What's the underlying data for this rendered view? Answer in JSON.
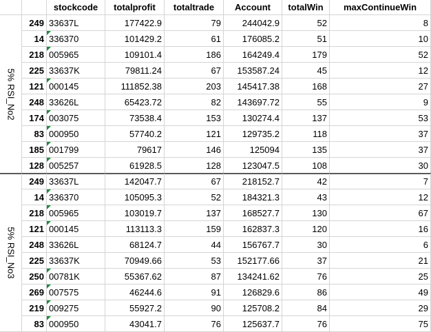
{
  "headers": [
    "",
    "",
    "stockcode",
    "totalprofit",
    "totaltrade",
    "Account",
    "totalWin",
    "maxContinueWin"
  ],
  "groups": [
    {
      "label": "5% RSI_No2",
      "rows": [
        {
          "idx": "249",
          "stockcode": "33637L",
          "totalprofit": "177422.9",
          "totaltrade": "79",
          "account": "244042.9",
          "totalwin": "52",
          "maxcontinuewin": "8",
          "flag": false
        },
        {
          "idx": "14",
          "stockcode": "336370",
          "totalprofit": "101429.2",
          "totaltrade": "61",
          "account": "176085.2",
          "totalwin": "51",
          "maxcontinuewin": "10",
          "flag": true
        },
        {
          "idx": "218",
          "stockcode": "005965",
          "totalprofit": "109101.4",
          "totaltrade": "186",
          "account": "164249.4",
          "totalwin": "179",
          "maxcontinuewin": "52",
          "flag": true
        },
        {
          "idx": "225",
          "stockcode": "33637K",
          "totalprofit": "79811.24",
          "totaltrade": "67",
          "account": "153587.24",
          "totalwin": "45",
          "maxcontinuewin": "12",
          "flag": false
        },
        {
          "idx": "121",
          "stockcode": "000145",
          "totalprofit": "111852.38",
          "totaltrade": "203",
          "account": "145417.38",
          "totalwin": "168",
          "maxcontinuewin": "27",
          "flag": true
        },
        {
          "idx": "248",
          "stockcode": "33626L",
          "totalprofit": "65423.72",
          "totaltrade": "82",
          "account": "143697.72",
          "totalwin": "55",
          "maxcontinuewin": "9",
          "flag": false
        },
        {
          "idx": "174",
          "stockcode": "003075",
          "totalprofit": "73538.4",
          "totaltrade": "153",
          "account": "130274.4",
          "totalwin": "137",
          "maxcontinuewin": "53",
          "flag": true
        },
        {
          "idx": "83",
          "stockcode": "000950",
          "totalprofit": "57740.2",
          "totaltrade": "121",
          "account": "129735.2",
          "totalwin": "118",
          "maxcontinuewin": "37",
          "flag": true
        },
        {
          "idx": "185",
          "stockcode": "001799",
          "totalprofit": "79617",
          "totaltrade": "146",
          "account": "125094",
          "totalwin": "135",
          "maxcontinuewin": "37",
          "flag": true
        },
        {
          "idx": "128",
          "stockcode": "005257",
          "totalprofit": "61928.5",
          "totaltrade": "128",
          "account": "123047.5",
          "totalwin": "108",
          "maxcontinuewin": "30",
          "flag": true
        }
      ]
    },
    {
      "label": "5% RSI_No3",
      "rows": [
        {
          "idx": "249",
          "stockcode": "33637L",
          "totalprofit": "142047.7",
          "totaltrade": "67",
          "account": "218152.7",
          "totalwin": "42",
          "maxcontinuewin": "7",
          "flag": false
        },
        {
          "idx": "14",
          "stockcode": "336370",
          "totalprofit": "105095.3",
          "totaltrade": "52",
          "account": "184321.3",
          "totalwin": "43",
          "maxcontinuewin": "12",
          "flag": true
        },
        {
          "idx": "218",
          "stockcode": "005965",
          "totalprofit": "103019.7",
          "totaltrade": "137",
          "account": "168527.7",
          "totalwin": "130",
          "maxcontinuewin": "67",
          "flag": true
        },
        {
          "idx": "121",
          "stockcode": "000145",
          "totalprofit": "113113.3",
          "totaltrade": "159",
          "account": "162837.3",
          "totalwin": "120",
          "maxcontinuewin": "16",
          "flag": true
        },
        {
          "idx": "248",
          "stockcode": "33626L",
          "totalprofit": "68124.7",
          "totaltrade": "44",
          "account": "156767.7",
          "totalwin": "30",
          "maxcontinuewin": "6",
          "flag": false
        },
        {
          "idx": "225",
          "stockcode": "33637K",
          "totalprofit": "70949.66",
          "totaltrade": "53",
          "account": "152177.66",
          "totalwin": "37",
          "maxcontinuewin": "21",
          "flag": false
        },
        {
          "idx": "250",
          "stockcode": "00781K",
          "totalprofit": "55367.62",
          "totaltrade": "87",
          "account": "134241.62",
          "totalwin": "76",
          "maxcontinuewin": "25",
          "flag": true
        },
        {
          "idx": "269",
          "stockcode": "007575",
          "totalprofit": "46244.6",
          "totaltrade": "91",
          "account": "126829.6",
          "totalwin": "86",
          "maxcontinuewin": "49",
          "flag": true
        },
        {
          "idx": "219",
          "stockcode": "009275",
          "totalprofit": "55927.2",
          "totaltrade": "90",
          "account": "125708.2",
          "totalwin": "84",
          "maxcontinuewin": "29",
          "flag": true
        },
        {
          "idx": "83",
          "stockcode": "000950",
          "totalprofit": "43041.7",
          "totaltrade": "76",
          "account": "125637.7",
          "totalwin": "76",
          "maxcontinuewin": "75",
          "flag": true
        }
      ]
    }
  ]
}
